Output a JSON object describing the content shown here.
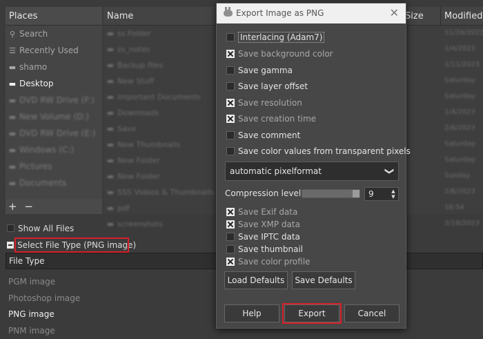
{
  "places": {
    "header": "Places",
    "items": [
      {
        "label": "Search",
        "icon": "search-icon",
        "glyph": "⚲",
        "style": "dim"
      },
      {
        "label": "Recently Used",
        "icon": "clock-icon",
        "glyph": "☰",
        "style": "dim"
      },
      {
        "label": "shamo",
        "icon": "folder-icon",
        "glyph": "▬",
        "style": "dim"
      },
      {
        "label": "Desktop",
        "icon": "folder-icon",
        "glyph": "▬",
        "style": "bright"
      },
      {
        "label": "DVD RW Drive (F:)",
        "icon": "drive-icon",
        "glyph": "▬",
        "style": "blur"
      },
      {
        "label": "New Volume (D:)",
        "icon": "drive-icon",
        "glyph": "▬",
        "style": "blur"
      },
      {
        "label": "DVD RW Drive (E:)",
        "icon": "drive-icon",
        "glyph": "▬",
        "style": "blur"
      },
      {
        "label": "Windows (C:)",
        "icon": "drive-icon",
        "glyph": "▬",
        "style": "blur"
      },
      {
        "label": "Pictures",
        "icon": "folder-icon",
        "glyph": "▬",
        "style": "blur"
      },
      {
        "label": "Documents",
        "icon": "folder-icon",
        "glyph": "▬",
        "style": "blur"
      }
    ],
    "add_label": "+",
    "remove_label": "−"
  },
  "files": {
    "columns": {
      "name": "Name",
      "size": "Size",
      "modified": "Modified"
    },
    "rows": [
      {
        "name": "ss Folder",
        "modified": "11/26/2022"
      },
      {
        "name": "ss_notes",
        "modified": "1/4/2023"
      },
      {
        "name": "Backup files",
        "modified": "1/11/2023"
      },
      {
        "name": "New Stuff",
        "modified": "Saturday"
      },
      {
        "name": "Important Documents",
        "modified": "Saturday"
      },
      {
        "name": "Downloads",
        "modified": "1/4/2023"
      },
      {
        "name": "Save",
        "modified": "2/6/2023"
      },
      {
        "name": "New Thumbnails",
        "modified": "Saturday"
      },
      {
        "name": "New Folder",
        "modified": "Saturday"
      },
      {
        "name": "New Folder",
        "modified": "Sunday"
      },
      {
        "name": "SSS Videos & Thumbnails",
        "modified": "2/6/2023"
      },
      {
        "name": "pdf",
        "modified": "16:54"
      },
      {
        "name": "screenshots",
        "modified": "2/18/2023"
      }
    ]
  },
  "show_all_files": "Show All Files",
  "select_file_type": "Select File Type (PNG image)",
  "file_type": {
    "header": "File Type",
    "items": [
      "PGM image",
      "Photoshop image",
      "PNG image",
      "PNM image"
    ],
    "selected_index": 2
  },
  "dialog": {
    "title": "Export Image as PNG",
    "close_glyph": "✕",
    "options": [
      {
        "label": "Interlacing (Adam7)",
        "checked": false
      },
      {
        "label": "Save background color",
        "checked": true
      },
      {
        "label": "Save gamma",
        "checked": false
      },
      {
        "label": "Save layer offset",
        "checked": false
      },
      {
        "label": "Save resolution",
        "checked": true
      },
      {
        "label": "Save creation time",
        "checked": true
      },
      {
        "label": "Save comment",
        "checked": false
      },
      {
        "label": "Save color values from transparent pixels",
        "checked": false
      }
    ],
    "pixelformat": {
      "value": "automatic pixelformat",
      "chevron": "❯"
    },
    "compression": {
      "label": "Compression level:",
      "value": "9",
      "fraction": 1.0
    },
    "metadata": [
      {
        "label": "Save Exif data",
        "checked": true
      },
      {
        "label": "Save XMP data",
        "checked": true
      },
      {
        "label": "Save IPTC data",
        "checked": false
      },
      {
        "label": "Save thumbnail",
        "checked": false
      },
      {
        "label": "Save color profile",
        "checked": true
      }
    ],
    "load_defaults": "Load Defaults",
    "save_defaults": "Save Defaults",
    "help": "Help",
    "export": "Export",
    "cancel": "Cancel"
  },
  "colors": {
    "highlight": "#d8202a"
  }
}
